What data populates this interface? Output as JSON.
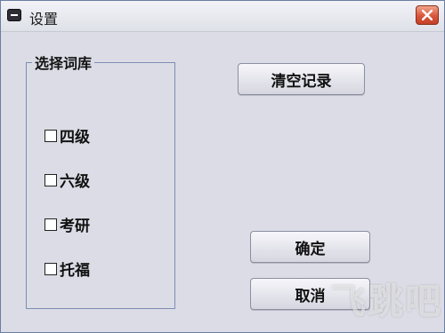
{
  "window": {
    "title": "设置",
    "system_icon": "window-menu-icon",
    "close_icon": "close-icon"
  },
  "group": {
    "label": "选择词库",
    "options": [
      {
        "label": "四级",
        "checked": false
      },
      {
        "label": "六级",
        "checked": false
      },
      {
        "label": "考研",
        "checked": false
      },
      {
        "label": "托福",
        "checked": false
      }
    ]
  },
  "buttons": {
    "clear": "清空记录",
    "ok": "确定",
    "cancel": "取消"
  },
  "watermark": "飞跳吧",
  "colors": {
    "window_bg": "#dcdce6",
    "close_button": "#d8553a",
    "group_border": "#7d8fb3"
  }
}
